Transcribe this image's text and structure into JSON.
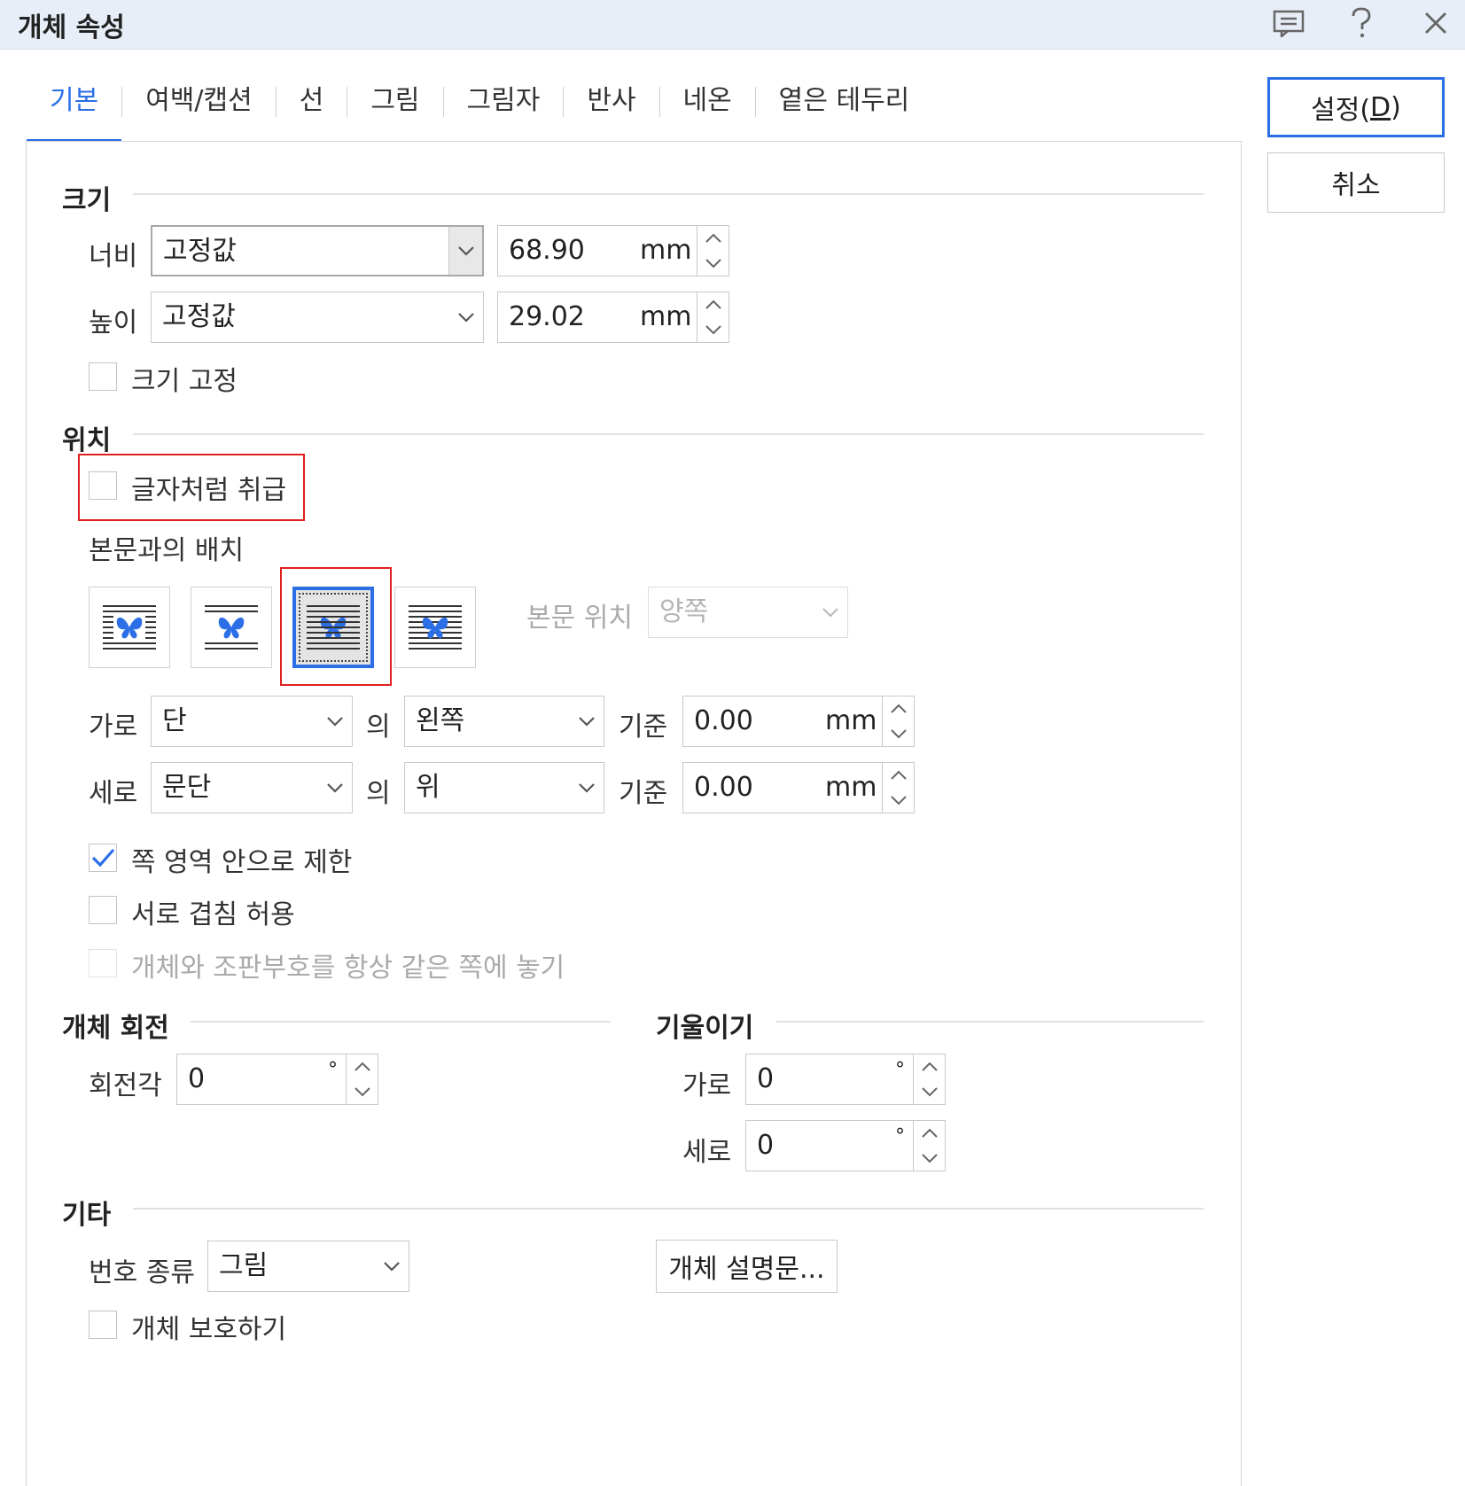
{
  "window": {
    "title": "개체 속성",
    "icons": [
      "comment-icon",
      "help-icon",
      "close-icon"
    ]
  },
  "tabs": [
    {
      "label": "기본",
      "active": true
    },
    {
      "label": "여백/캡션"
    },
    {
      "label": "선"
    },
    {
      "label": "그림"
    },
    {
      "label": "그림자"
    },
    {
      "label": "반사"
    },
    {
      "label": "네온"
    },
    {
      "label": "옅은 테두리"
    }
  ],
  "buttons": {
    "ok_prefix": "설정(",
    "ok_key": "D",
    "ok_suffix": ")",
    "cancel": "취소"
  },
  "size": {
    "title": "크기",
    "width_label": "너비",
    "width_mode": "고정값",
    "width_value": "68.90",
    "height_label": "높이",
    "height_mode": "고정값",
    "height_value": "29.02",
    "unit": "mm",
    "lock_label": "크기 고정",
    "lock_checked": false
  },
  "position": {
    "title": "위치",
    "treat_as_char_label": "글자처럼 취급",
    "treat_as_char_checked": false,
    "wrap_label": "본문과의 배치",
    "wrap_options": [
      "square-wrap-icon",
      "top-bottom-wrap-icon",
      "behind-text-icon",
      "in-front-of-text-icon"
    ],
    "wrap_selected_index": 2,
    "text_pos_label": "본문 위치",
    "text_pos_value": "양쪽",
    "horiz_label": "가로",
    "horiz_ref": "단",
    "of_label": "의",
    "horiz_align": "왼쪽",
    "base_label": "기준",
    "horiz_offset": "0.00",
    "vert_label": "세로",
    "vert_ref": "문단",
    "vert_align": "위",
    "vert_offset": "0.00",
    "unit": "mm",
    "limit_label": "쪽 영역 안으로 제한",
    "limit_checked": true,
    "overlap_label": "서로 겹침 허용",
    "overlap_checked": false,
    "same_page_label": "개체와 조판부호를 항상 같은 쪽에 놓기",
    "same_page_checked": false
  },
  "rotation": {
    "title": "개체 회전",
    "angle_label": "회전각",
    "angle_value": "0",
    "deg": "°"
  },
  "skew": {
    "title": "기울이기",
    "horiz_label": "가로",
    "horiz_value": "0",
    "vert_label": "세로",
    "vert_value": "0",
    "deg": "°"
  },
  "etc": {
    "title": "기타",
    "number_type_label": "번호 종류",
    "number_type_value": "그림",
    "description_button": "개체 설명문...",
    "protect_label": "개체 보호하기",
    "protect_checked": false
  },
  "colors": {
    "accent": "#2b6ee6",
    "highlight": "#e02020",
    "titlebar": "#e8eef8"
  }
}
